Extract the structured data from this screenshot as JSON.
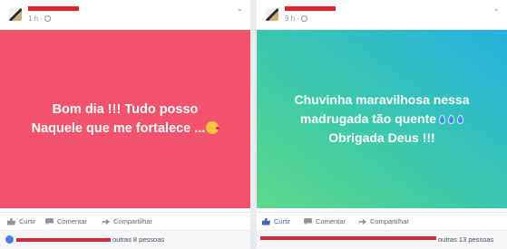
{
  "posts": [
    {
      "time": "1 h",
      "text": "Bom dia !!! Tudo posso\nNaquele que me fortalece ...",
      "emoji_icon": "kissing-face-icon",
      "background_color": "#f3526c",
      "actions": {
        "like": "Curtir",
        "comment": "Comentar",
        "share": "Compartilhar"
      },
      "reactions_text": "outras 8 pessoas"
    },
    {
      "time": "9 h",
      "text": "Chuvinha maravilhosa nessa\nmadrugada tão quente",
      "text_line2": "Obrigada Deus !!!",
      "emoji_icon": "droplet-icon",
      "background_colors": [
        "#5fd98c",
        "#24b0e0"
      ],
      "actions": {
        "like": "Curtir",
        "comment": "Comentar",
        "share": "Compartilhar"
      },
      "liked": true,
      "reactions_text": "outras 13 pessoas"
    }
  ],
  "colors": {
    "like_active": "#4267b2",
    "redaction": "#e0202a"
  }
}
